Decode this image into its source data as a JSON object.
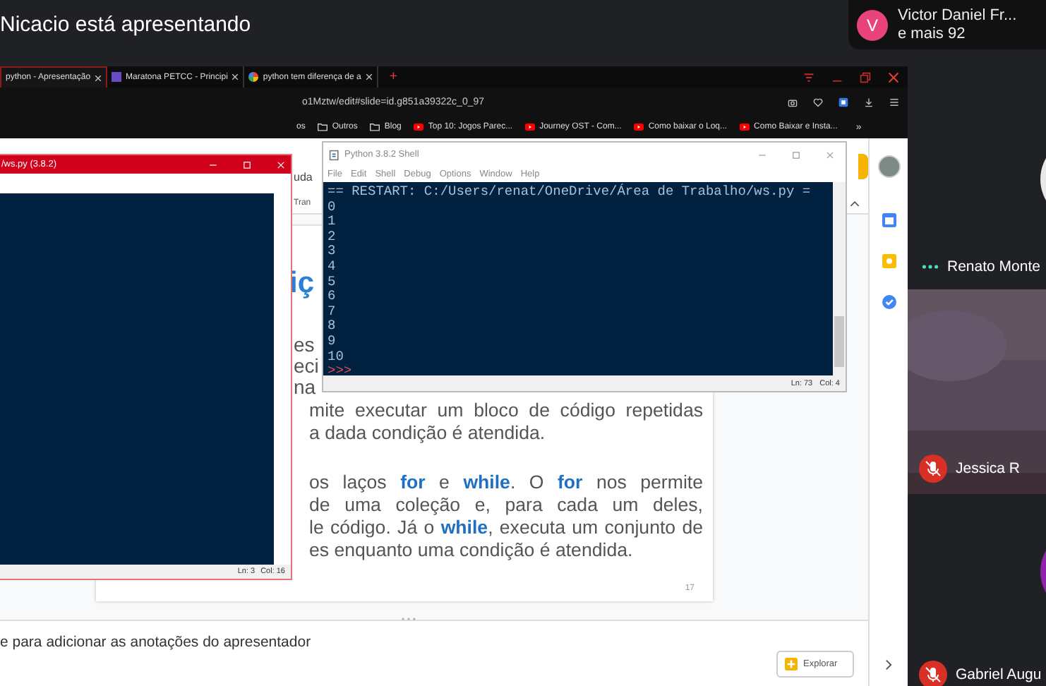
{
  "meeting": {
    "presenter_banner": "Nicacio está apresentando",
    "participants_chip": {
      "avatar": "V",
      "name": "Victor Daniel Fr...",
      "more": "e mais 92"
    }
  },
  "browser": {
    "tabs": [
      {
        "label": "python - Apresentação",
        "selected": true,
        "kind": "slides"
      },
      {
        "label": "Maratona PETCC - Principi",
        "selected": false,
        "kind": "forms"
      },
      {
        "label": "python tem diferença de a",
        "selected": false,
        "kind": "google"
      }
    ],
    "new_tab": "+",
    "address": "o1Mztw/edit#slide=id.g851a39322c_0_97",
    "bookmarks": [
      {
        "label": "os",
        "kind": "text"
      },
      {
        "label": "Outros",
        "kind": "folder"
      },
      {
        "label": "Blog",
        "kind": "folder"
      },
      {
        "label": "Top 10: Jogos Parec...",
        "kind": "video"
      },
      {
        "label": "Journey OST - Com...",
        "kind": "video"
      },
      {
        "label": "Como baixar o Loq...",
        "kind": "video"
      },
      {
        "label": "Como Baixar e Insta...",
        "kind": "video"
      }
    ],
    "bookmarks_more": "»"
  },
  "slides": {
    "menu_fragment": "uda",
    "toolbar_fragment": "Tran",
    "heading_fragment": "iç",
    "fragments": [
      "es",
      "eci",
      "na"
    ],
    "lines": [
      {
        "text": "mite executar um bloco de código repetidas",
        "gap": false
      },
      {
        "text": "a dada condição é atendida.",
        "gap": false
      },
      {
        "text": "os laços **for** e **while**. O **for** nos permite",
        "gap": true
      },
      {
        "text": "de uma coleção e, para cada um deles,",
        "gap": false
      },
      {
        "text": "le código. Já o **while**, executa um conjunto de",
        "gap": false
      },
      {
        "text": "es enquanto uma condição é atendida.",
        "gap": false
      }
    ],
    "slide_number": "17",
    "notes_placeholder": "e para adicionar as anotações do apresentador",
    "explore_button": "Explorar"
  },
  "editor_window": {
    "title": "/ws.py (3.8.2)",
    "status_line": "Ln: 3",
    "status_col": "Col: 16"
  },
  "shell_window": {
    "title": "Python 3.8.2 Shell",
    "menu": [
      "File",
      "Edit",
      "Shell",
      "Debug",
      "Options",
      "Window",
      "Help"
    ],
    "lines": [
      "== RESTART: C:/Users/renat/OneDrive/Área de Trabalho/ws.py =",
      "0",
      "1",
      "2",
      "3",
      "4",
      "5",
      "6",
      "7",
      "8",
      "9",
      "10"
    ],
    "prompt": ">>>",
    "status_line": "Ln: 73",
    "status_col": "Col: 4"
  },
  "participants": [
    {
      "name": "Renato Monte",
      "kind": "speaking",
      "video": false
    },
    {
      "name": "Jessica R",
      "kind": "muted",
      "video": true
    },
    {
      "name": "Gabriel Augu",
      "kind": "muted",
      "video": false
    }
  ]
}
